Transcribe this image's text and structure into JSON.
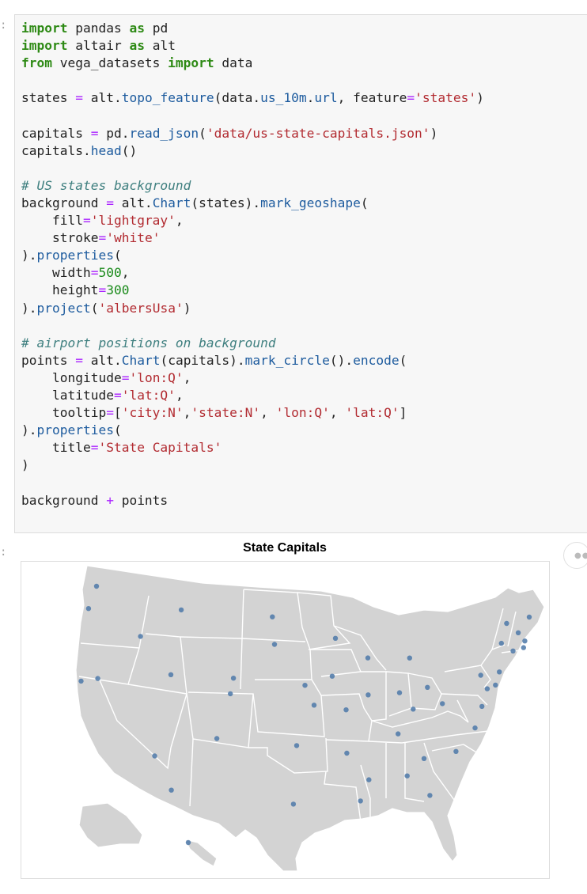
{
  "cells": {
    "input_prompt": ":",
    "output_prompt": ":"
  },
  "code": {
    "lines": [
      [
        [
          "kw",
          "import"
        ],
        [
          "t",
          " pandas "
        ],
        [
          "kw",
          "as"
        ],
        [
          "t",
          " pd"
        ]
      ],
      [
        [
          "kw",
          "import"
        ],
        [
          "t",
          " altair "
        ],
        [
          "kw",
          "as"
        ],
        [
          "t",
          " alt"
        ]
      ],
      [
        [
          "kw",
          "from"
        ],
        [
          "t",
          " vega_datasets "
        ],
        [
          "kw",
          "import"
        ],
        [
          "t",
          " data"
        ]
      ],
      [],
      [
        [
          "t",
          "states "
        ],
        [
          "op",
          "="
        ],
        [
          "t",
          " alt."
        ],
        [
          "at",
          "topo_feature"
        ],
        [
          "t",
          "(data."
        ],
        [
          "at",
          "us_10m"
        ],
        [
          "t",
          "."
        ],
        [
          "at",
          "url"
        ],
        [
          "t",
          ", feature"
        ],
        [
          "op",
          "="
        ],
        [
          "st",
          "'states'"
        ],
        [
          "t",
          ")"
        ]
      ],
      [],
      [
        [
          "t",
          "capitals "
        ],
        [
          "op",
          "="
        ],
        [
          "t",
          " pd."
        ],
        [
          "at",
          "read_json"
        ],
        [
          "t",
          "("
        ],
        [
          "st",
          "'data/us-state-capitals.json'"
        ],
        [
          "t",
          ")"
        ]
      ],
      [
        [
          "t",
          "capitals."
        ],
        [
          "at",
          "head"
        ],
        [
          "t",
          "()"
        ]
      ],
      [],
      [
        [
          "cm",
          "# US states background"
        ]
      ],
      [
        [
          "t",
          "background "
        ],
        [
          "op",
          "="
        ],
        [
          "t",
          " alt."
        ],
        [
          "at",
          "Chart"
        ],
        [
          "t",
          "(states)."
        ],
        [
          "at",
          "mark_geoshape"
        ],
        [
          "t",
          "("
        ]
      ],
      [
        [
          "t",
          "    fill"
        ],
        [
          "op",
          "="
        ],
        [
          "st",
          "'lightgray'"
        ],
        [
          "t",
          ","
        ]
      ],
      [
        [
          "t",
          "    stroke"
        ],
        [
          "op",
          "="
        ],
        [
          "st",
          "'white'"
        ]
      ],
      [
        [
          "t",
          ")."
        ],
        [
          "at",
          "properties"
        ],
        [
          "t",
          "("
        ]
      ],
      [
        [
          "t",
          "    width"
        ],
        [
          "op",
          "="
        ],
        [
          "nu",
          "500"
        ],
        [
          "t",
          ","
        ]
      ],
      [
        [
          "t",
          "    height"
        ],
        [
          "op",
          "="
        ],
        [
          "nu",
          "300"
        ]
      ],
      [
        [
          "t",
          ")."
        ],
        [
          "at",
          "project"
        ],
        [
          "t",
          "("
        ],
        [
          "st",
          "'albersUsa'"
        ],
        [
          "t",
          ")"
        ]
      ],
      [],
      [
        [
          "cm",
          "# airport positions on background"
        ]
      ],
      [
        [
          "t",
          "points "
        ],
        [
          "op",
          "="
        ],
        [
          "t",
          " alt."
        ],
        [
          "at",
          "Chart"
        ],
        [
          "t",
          "(capitals)."
        ],
        [
          "at",
          "mark_circle"
        ],
        [
          "t",
          "()."
        ],
        [
          "at",
          "encode"
        ],
        [
          "t",
          "("
        ]
      ],
      [
        [
          "t",
          "    longitude"
        ],
        [
          "op",
          "="
        ],
        [
          "st",
          "'lon:Q'"
        ],
        [
          "t",
          ","
        ]
      ],
      [
        [
          "t",
          "    latitude"
        ],
        [
          "op",
          "="
        ],
        [
          "st",
          "'lat:Q'"
        ],
        [
          "t",
          ","
        ]
      ],
      [
        [
          "t",
          "    tooltip"
        ],
        [
          "op",
          "="
        ],
        [
          "t",
          "["
        ],
        [
          "st",
          "'city:N'"
        ],
        [
          "t",
          ","
        ],
        [
          "st",
          "'state:N'"
        ],
        [
          "t",
          ", "
        ],
        [
          "st",
          "'lon:Q'"
        ],
        [
          "t",
          ", "
        ],
        [
          "st",
          "'lat:Q'"
        ],
        [
          "t",
          "]"
        ]
      ],
      [
        [
          "t",
          ")."
        ],
        [
          "at",
          "properties"
        ],
        [
          "t",
          "("
        ]
      ],
      [
        [
          "t",
          "    title"
        ],
        [
          "op",
          "="
        ],
        [
          "st",
          "'State Capitals'"
        ]
      ],
      [
        [
          "t",
          ")"
        ]
      ],
      [],
      [
        [
          "t",
          "background "
        ],
        [
          "op",
          "+"
        ],
        [
          "t",
          " points"
        ]
      ]
    ]
  },
  "chart_data": {
    "type": "scatter",
    "title": "State Capitals",
    "projection": "albersUsa",
    "background": "US states, fill lightgray, stroke white",
    "point_color": "#4c78a8",
    "state_fill": "#d3d3d3",
    "legend": "none",
    "grid": false,
    "points": [
      {
        "lon": -122.9,
        "lat": 47.04
      },
      {
        "lon": -123.03,
        "lat": 44.94
      },
      {
        "lon": -121.47,
        "lat": 38.58
      },
      {
        "lon": -119.77,
        "lat": 39.16
      },
      {
        "lon": -116.2,
        "lat": 43.61
      },
      {
        "lon": -112.03,
        "lat": 46.59
      },
      {
        "lon": -111.89,
        "lat": 40.76
      },
      {
        "lon": -112.07,
        "lat": 33.45
      },
      {
        "lon": -105.94,
        "lat": 35.69
      },
      {
        "lon": -104.99,
        "lat": 39.74
      },
      {
        "lon": -104.82,
        "lat": 41.14
      },
      {
        "lon": -100.78,
        "lat": 46.81
      },
      {
        "lon": -100.35,
        "lat": 44.37
      },
      {
        "lon": -96.7,
        "lat": 40.81
      },
      {
        "lon": -95.68,
        "lat": 39.05
      },
      {
        "lon": -97.52,
        "lat": 35.47
      },
      {
        "lon": -97.74,
        "lat": 30.27
      },
      {
        "lon": -93.09,
        "lat": 44.95
      },
      {
        "lon": -93.6,
        "lat": 41.59
      },
      {
        "lon": -92.17,
        "lat": 38.58
      },
      {
        "lon": -92.29,
        "lat": 34.75
      },
      {
        "lon": -91.14,
        "lat": 30.46
      },
      {
        "lon": -89.38,
        "lat": 43.07
      },
      {
        "lon": -89.65,
        "lat": 39.8
      },
      {
        "lon": -84.55,
        "lat": 42.73
      },
      {
        "lon": -86.16,
        "lat": 39.77
      },
      {
        "lon": -82.99,
        "lat": 39.96
      },
      {
        "lon": -84.87,
        "lat": 38.2
      },
      {
        "lon": -86.78,
        "lat": 36.16
      },
      {
        "lon": -90.18,
        "lat": 32.3
      },
      {
        "lon": -86.3,
        "lat": 32.38
      },
      {
        "lon": -84.39,
        "lat": 33.75
      },
      {
        "lon": -84.28,
        "lat": 30.44
      },
      {
        "lon": -81.03,
        "lat": 34.0
      },
      {
        "lon": -78.64,
        "lat": 35.78
      },
      {
        "lon": -77.46,
        "lat": 37.54
      },
      {
        "lon": -81.63,
        "lat": 38.35
      },
      {
        "lon": -76.88,
        "lat": 40.26
      },
      {
        "lon": -73.76,
        "lat": 42.65
      },
      {
        "lon": -74.76,
        "lat": 40.22
      },
      {
        "lon": -76.49,
        "lat": 38.98
      },
      {
        "lon": -75.52,
        "lat": 39.16
      },
      {
        "lon": -72.68,
        "lat": 41.76
      },
      {
        "lon": -71.41,
        "lat": 41.82
      },
      {
        "lon": -71.06,
        "lat": 42.36
      },
      {
        "lon": -72.58,
        "lat": 44.26
      },
      {
        "lon": -71.54,
        "lat": 43.21
      },
      {
        "lon": -69.78,
        "lat": 44.31
      },
      {
        "lon": -134.42,
        "lat": 58.3
      },
      {
        "lon": -157.83,
        "lat": 21.31
      }
    ]
  }
}
